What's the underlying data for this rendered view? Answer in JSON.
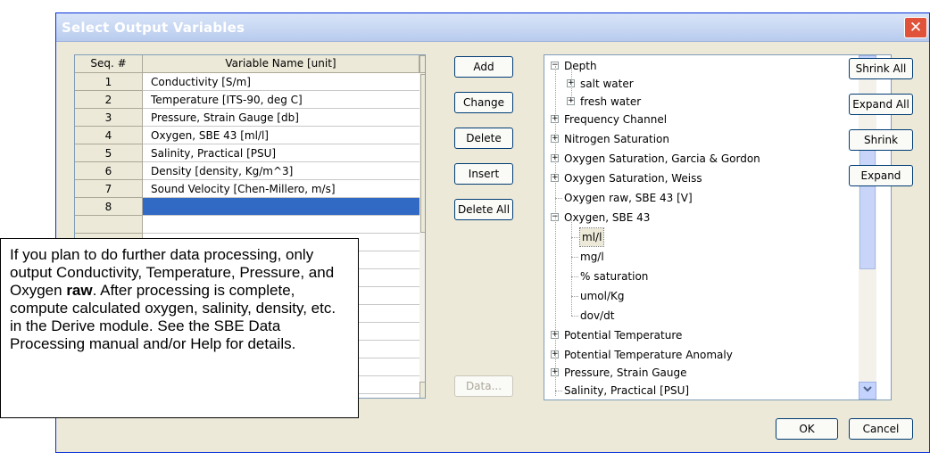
{
  "window": {
    "title": "Select Output Variables",
    "close_glyph": "✕"
  },
  "grid": {
    "headers": {
      "seq": "Seq. #",
      "variable": "Variable Name [unit]"
    },
    "rows": [
      {
        "seq": "1",
        "name": "Conductivity [S/m]"
      },
      {
        "seq": "2",
        "name": "Temperature [ITS-90, deg C]"
      },
      {
        "seq": "3",
        "name": "Pressure, Strain Gauge [db]"
      },
      {
        "seq": "4",
        "name": "Oxygen, SBE 43 [ml/l]"
      },
      {
        "seq": "5",
        "name": "Salinity, Practical [PSU]"
      },
      {
        "seq": "6",
        "name": "Density [density, Kg/m^3]"
      },
      {
        "seq": "7",
        "name": "Sound Velocity [Chen-Millero, m/s]"
      },
      {
        "seq": "8",
        "name": ""
      }
    ]
  },
  "buttons": {
    "add": "Add",
    "change": "Change",
    "delete": "Delete",
    "insert": "Insert",
    "delete_all": "Delete All",
    "data": "Data...",
    "shrink_all": "Shrink All",
    "expand_all": "Expand All",
    "shrink": "Shrink",
    "expand": "Expand",
    "ok": "OK",
    "cancel": "Cancel"
  },
  "tree": {
    "items": [
      {
        "label": "Depth",
        "toggle": "−"
      },
      {
        "label": "salt water",
        "toggle": "+"
      },
      {
        "label": "fresh water",
        "toggle": "+"
      },
      {
        "label": "Frequency Channel",
        "toggle": "+"
      },
      {
        "label": "Nitrogen Saturation",
        "toggle": "+"
      },
      {
        "label": "Oxygen Saturation, Garcia & Gordon",
        "toggle": "+"
      },
      {
        "label": "Oxygen Saturation, Weiss",
        "toggle": "+"
      },
      {
        "label": "Oxygen raw, SBE 43 [V]",
        "toggle": ""
      },
      {
        "label": "Oxygen, SBE 43",
        "toggle": "−"
      },
      {
        "label": "ml/l",
        "toggle": ""
      },
      {
        "label": "mg/l",
        "toggle": ""
      },
      {
        "label": "% saturation",
        "toggle": ""
      },
      {
        "label": "umol/Kg",
        "toggle": ""
      },
      {
        "label": "dov/dt",
        "toggle": ""
      },
      {
        "label": "Potential Temperature",
        "toggle": "+"
      },
      {
        "label": "Potential Temperature Anomaly",
        "toggle": "+"
      },
      {
        "label": "Pressure, Strain Gauge",
        "toggle": "+"
      },
      {
        "label": "Salinity, Practical [PSU]",
        "toggle": ""
      }
    ]
  },
  "callout": {
    "part1": "If you plan to do further data processing, only output Conductivity, Temperature, Pressure, and Oxygen ",
    "bold": "raw",
    "part2": ". After processing is complete, compute calculated oxygen, salinity, density, etc. in the Derive module. See the SBE Data Processing manual and/or Help for details."
  },
  "icons": {
    "scroll_up": "▲",
    "scroll_down": "▼",
    "tree_scroll_up": "up-chevron-icon",
    "tree_scroll_down": "down-chevron-icon"
  },
  "colors": {
    "selection": "#316ac5",
    "dialog_bg": "#ece9d8",
    "titlebar": "#c6d6f2",
    "close": "#e0533a"
  }
}
